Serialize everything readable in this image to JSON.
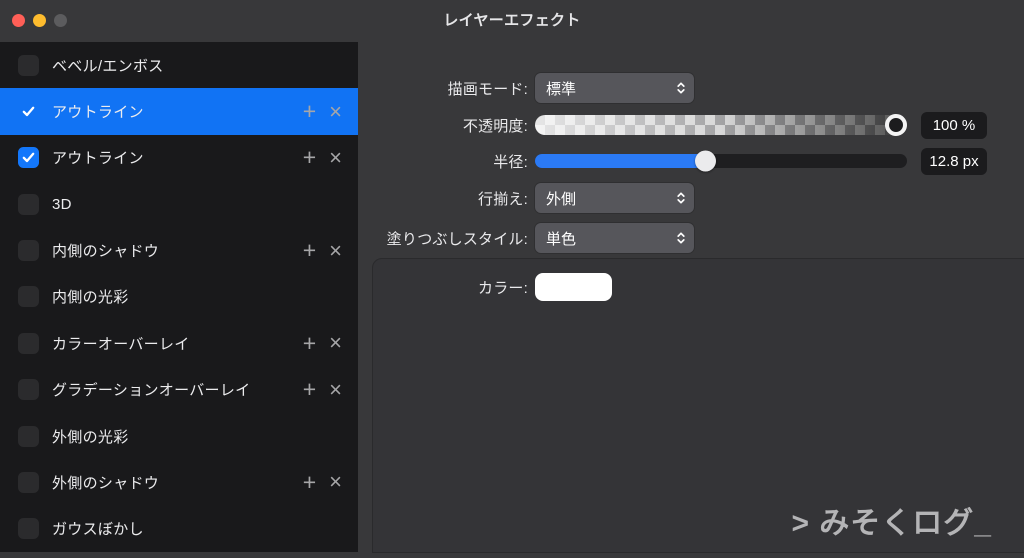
{
  "window": {
    "title": "レイヤーエフェクト",
    "bg": "#38383a",
    "panel_bg": "#343437",
    "sidebar_bg": "#19191b",
    "accent_blue": "#1173f4",
    "checkbox_blue": "#1377fb",
    "slider_blue": "#2b7af5"
  },
  "titlebar": {
    "close_color": "#ff5f57",
    "minimize_color": "#febc2e",
    "zoom_color": "#5c5c5e"
  },
  "sidebar": {
    "add_label": "+",
    "remove_label": "×",
    "items": [
      {
        "label": "ベベル/エンボス",
        "checked": false,
        "selected": false,
        "actions": false
      },
      {
        "label": "アウトライン",
        "checked": true,
        "selected": true,
        "actions": true
      },
      {
        "label": "アウトライン",
        "checked": true,
        "selected": false,
        "actions": true
      },
      {
        "label": "3D",
        "checked": false,
        "selected": false,
        "actions": false
      },
      {
        "label": "内側のシャドウ",
        "checked": false,
        "selected": false,
        "actions": true
      },
      {
        "label": "内側の光彩",
        "checked": false,
        "selected": false,
        "actions": false
      },
      {
        "label": "カラーオーバーレイ",
        "checked": false,
        "selected": false,
        "actions": true
      },
      {
        "label": "グラデーションオーバーレイ",
        "checked": false,
        "selected": false,
        "actions": true
      },
      {
        "label": "外側の光彩",
        "checked": false,
        "selected": false,
        "actions": false
      },
      {
        "label": "外側のシャドウ",
        "checked": false,
        "selected": false,
        "actions": true
      },
      {
        "label": "ガウスぼかし",
        "checked": false,
        "selected": false,
        "actions": false
      }
    ]
  },
  "controls": {
    "blend_mode": {
      "label": "描画モード:",
      "value": "標準"
    },
    "opacity": {
      "label": "不透明度:",
      "value": "100 %",
      "fill_percent": 100
    },
    "radius": {
      "label": "半径:",
      "value": "12.8 px",
      "fill_percent": 45.5
    },
    "alignment": {
      "label": "行揃え:",
      "value": "外側"
    },
    "fill_style": {
      "label": "塗りつぶしスタイル:",
      "value": "単色"
    },
    "color": {
      "label": "カラー:",
      "swatch": "#ffffff"
    }
  },
  "watermark": "> みそくログ_"
}
